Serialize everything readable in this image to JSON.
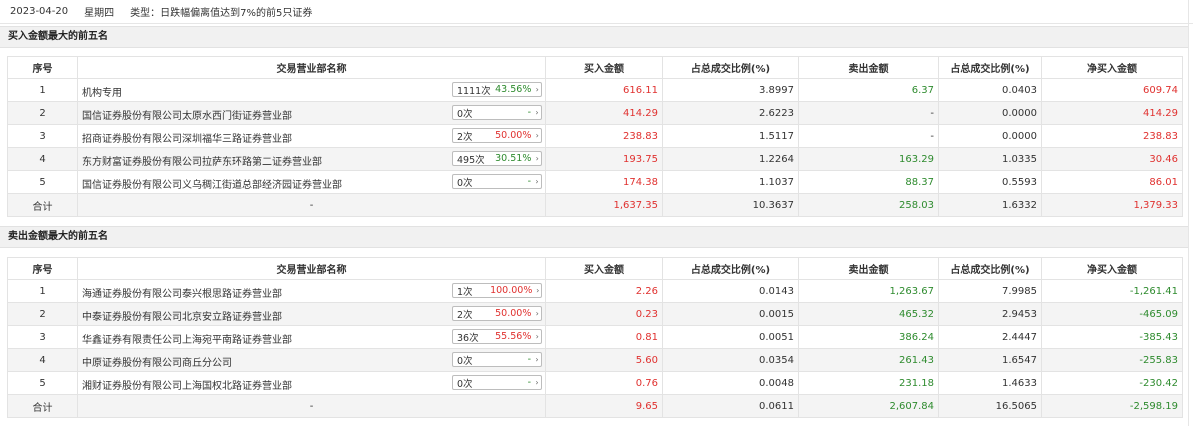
{
  "header": {
    "date": "2023-04-20",
    "weekday": "星期四",
    "type_label": "类型：",
    "type_value": "日跌幅偏离值达到7%的前5只证券"
  },
  "columns": [
    "序号",
    "交易营业部名称",
    "买入金额",
    "占总成交比例(%)",
    "卖出金额",
    "占总成交比例(%)",
    "净买入金额"
  ],
  "buy_section": {
    "title": "买入金额最大的前五名",
    "rows": [
      {
        "idx": "1",
        "name": "机构专用",
        "count": "1111次",
        "pct": "43.56%",
        "pct_color": "green",
        "buy": "616.11",
        "buy_ratio": "3.8997",
        "sell": "6.37",
        "sell_ratio": "0.0403",
        "net": "609.74",
        "net_color": "red"
      },
      {
        "idx": "2",
        "name": "国信证券股份有限公司太原水西门街证券营业部",
        "count": "0次",
        "pct": "-",
        "pct_color": "dark",
        "buy": "414.29",
        "buy_ratio": "2.6223",
        "sell": "-",
        "sell_ratio": "0.0000",
        "net": "414.29",
        "net_color": "red"
      },
      {
        "idx": "3",
        "name": "招商证券股份有限公司深圳福华三路证券营业部",
        "count": "2次",
        "pct": "50.00%",
        "pct_color": "red",
        "buy": "238.83",
        "buy_ratio": "1.5117",
        "sell": "-",
        "sell_ratio": "0.0000",
        "net": "238.83",
        "net_color": "red"
      },
      {
        "idx": "4",
        "name": "东方财富证券股份有限公司拉萨东环路第二证券营业部",
        "count": "495次",
        "pct": "30.51%",
        "pct_color": "green",
        "buy": "193.75",
        "buy_ratio": "1.2264",
        "sell": "163.29",
        "sell_ratio": "1.0335",
        "net": "30.46",
        "net_color": "red"
      },
      {
        "idx": "5",
        "name": "国信证券股份有限公司义乌稠江街道总部经济园证券营业部",
        "count": "0次",
        "pct": "-",
        "pct_color": "dark",
        "buy": "174.38",
        "buy_ratio": "1.1037",
        "sell": "88.37",
        "sell_ratio": "0.5593",
        "net": "86.01",
        "net_color": "red"
      }
    ],
    "total": {
      "label": "合计",
      "name": "-",
      "buy": "1,637.35",
      "buy_ratio": "10.3637",
      "sell": "258.03",
      "sell_ratio": "1.6332",
      "net": "1,379.33",
      "net_color": "red"
    }
  },
  "sell_section": {
    "title": "卖出金额最大的前五名",
    "rows": [
      {
        "idx": "1",
        "name": "海通证券股份有限公司泰兴根思路证券营业部",
        "count": "1次",
        "pct": "100.00%",
        "pct_color": "red",
        "buy": "2.26",
        "buy_ratio": "0.0143",
        "sell": "1,263.67",
        "sell_ratio": "7.9985",
        "net": "-1,261.41",
        "net_color": "green"
      },
      {
        "idx": "2",
        "name": "中泰证券股份有限公司北京安立路证券营业部",
        "count": "2次",
        "pct": "50.00%",
        "pct_color": "red",
        "buy": "0.23",
        "buy_ratio": "0.0015",
        "sell": "465.32",
        "sell_ratio": "2.9453",
        "net": "-465.09",
        "net_color": "green"
      },
      {
        "idx": "3",
        "name": "华鑫证券有限责任公司上海宛平南路证券营业部",
        "count": "36次",
        "pct": "55.56%",
        "pct_color": "red",
        "buy": "0.81",
        "buy_ratio": "0.0051",
        "sell": "386.24",
        "sell_ratio": "2.4447",
        "net": "-385.43",
        "net_color": "green"
      },
      {
        "idx": "4",
        "name": "中原证券股份有限公司商丘分公司",
        "count": "0次",
        "pct": "-",
        "pct_color": "dark",
        "buy": "5.60",
        "buy_ratio": "0.0354",
        "sell": "261.43",
        "sell_ratio": "1.6547",
        "net": "-255.83",
        "net_color": "green"
      },
      {
        "idx": "5",
        "name": "湘财证券股份有限公司上海国权北路证券营业部",
        "count": "0次",
        "pct": "-",
        "pct_color": "dark",
        "buy": "0.76",
        "buy_ratio": "0.0048",
        "sell": "231.18",
        "sell_ratio": "1.4633",
        "net": "-230.42",
        "net_color": "green"
      }
    ],
    "total": {
      "label": "合计",
      "name": "-",
      "buy": "9.65",
      "buy_ratio": "0.0611",
      "sell": "2,607.84",
      "sell_ratio": "16.5065",
      "net": "-2,598.19",
      "net_color": "green"
    }
  }
}
